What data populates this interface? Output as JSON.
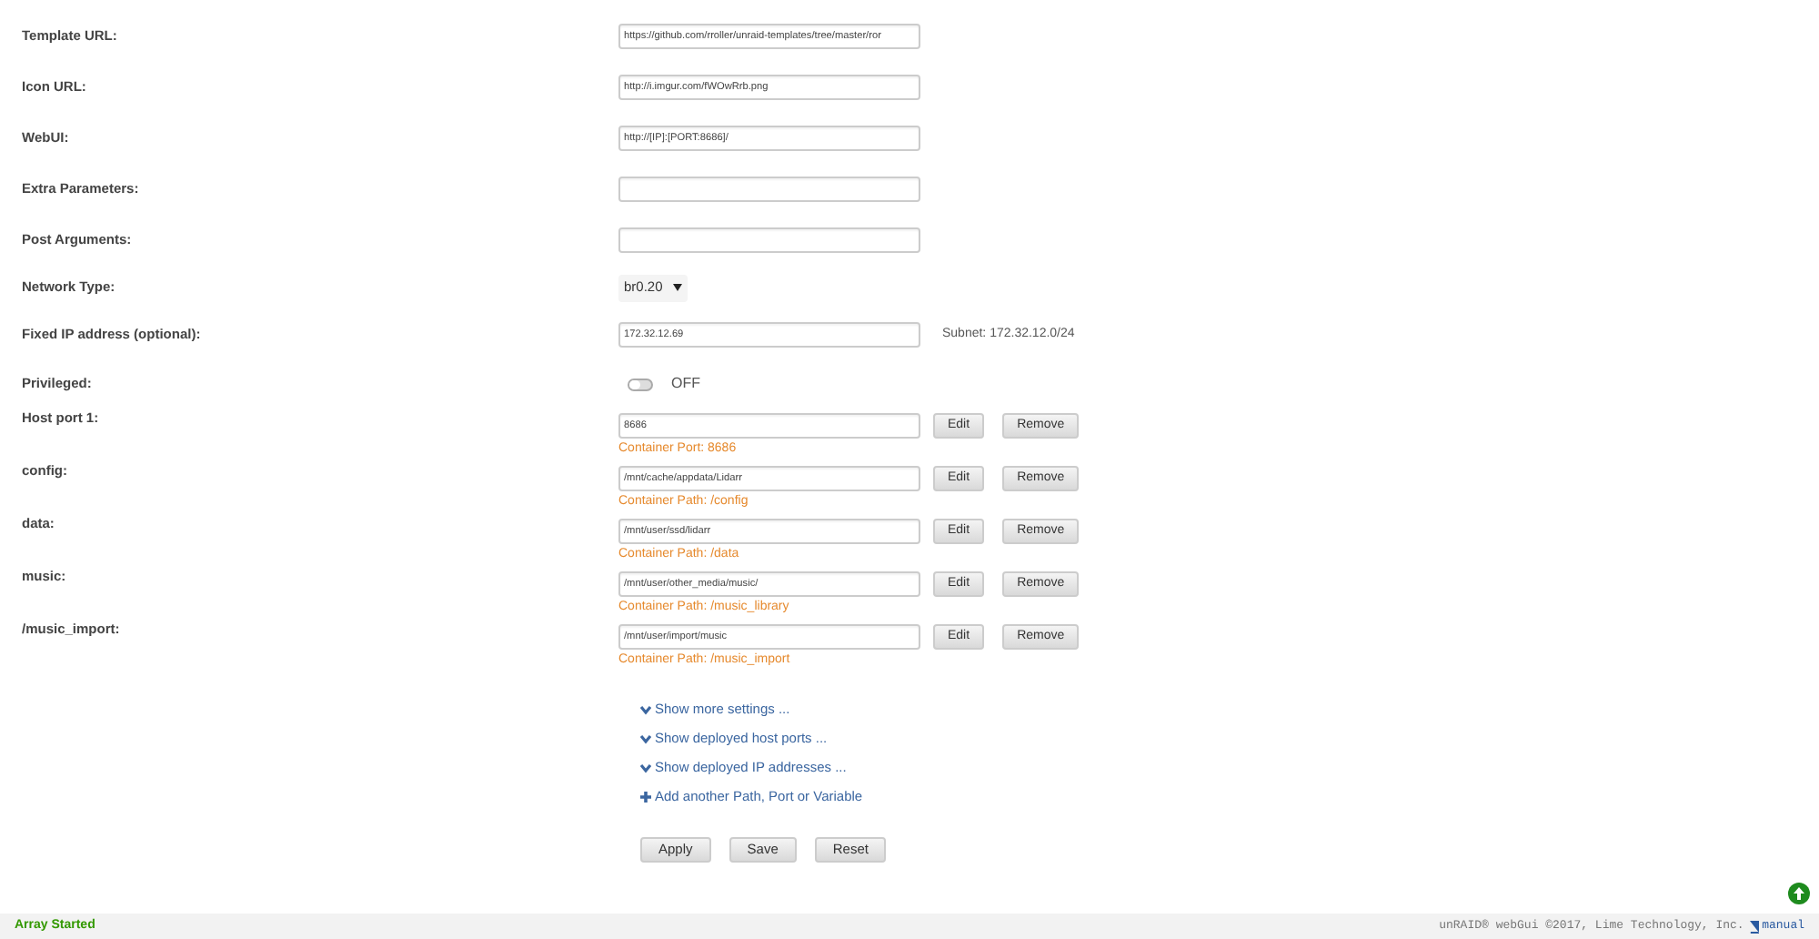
{
  "fields": [
    {
      "label": "Template URL:",
      "kind": "text",
      "value": "https://github.com/rroller/unraid-templates/tree/master/ror"
    },
    {
      "label": "Icon URL:",
      "kind": "text",
      "value": "http://i.imgur.com/fWOwRrb.png"
    },
    {
      "label": "WebUI:",
      "kind": "text",
      "value": "http://[IP]:[PORT:8686]/"
    },
    {
      "label": "Extra Parameters:",
      "kind": "text"
    },
    {
      "label": "Post Arguments:",
      "kind": "text"
    },
    {
      "label": "Network Type:",
      "kind": "select",
      "value": "br0.20"
    },
    {
      "label": "Fixed IP address (optional):",
      "kind": "text",
      "value": "172.32.12.69",
      "note": "Subnet: 172.32.12.0/24"
    },
    {
      "label": "Privileged:",
      "kind": "toggle",
      "on": false,
      "state_text": "OFF"
    }
  ],
  "mappings": [
    {
      "label": "Host port 1:",
      "value": "8686",
      "container": "Container Port: 8686",
      "buttons": [
        "Edit",
        "Remove"
      ]
    },
    {
      "label": "config:",
      "value": "/mnt/cache/appdata/Lidarr",
      "container": "Container Path: /config",
      "buttons": [
        "Edit",
        "Remove"
      ]
    },
    {
      "label": "data:",
      "value": "/mnt/user/ssd/lidarr",
      "container": "Container Path: /data",
      "buttons": [
        "Edit",
        "Remove"
      ]
    },
    {
      "label": "music:",
      "value": "/mnt/user/other_media/music/",
      "container": "Container Path: /music_library",
      "buttons": [
        "Edit",
        "Remove"
      ]
    },
    {
      "label": "/music_import:",
      "value": "/mnt/user/import/music",
      "container": "Container Path: /music_import",
      "buttons": [
        "Edit",
        "Remove"
      ]
    }
  ],
  "links": [
    {
      "kind": "expand",
      "text": "Show more settings ..."
    },
    {
      "kind": "expand",
      "text": "Show deployed host ports ..."
    },
    {
      "kind": "expand",
      "text": "Show deployed IP addresses ..."
    },
    {
      "kind": "add",
      "text": "Add another Path, Port or Variable"
    }
  ],
  "actions": [
    "Apply",
    "Save",
    "Reset"
  ],
  "footer": {
    "status": "Array Started",
    "copyright": "unRAID® webGui ©2017, Lime Technology, Inc.",
    "manual": "manual"
  }
}
